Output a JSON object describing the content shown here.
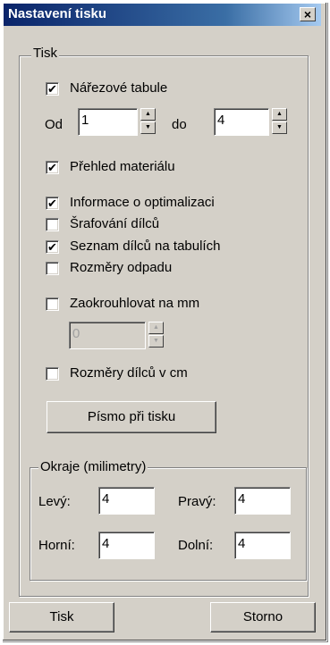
{
  "window": {
    "title": "Nastavení tisku",
    "close_glyph": "×"
  },
  "print_group": {
    "label": "Tisk",
    "cutting_sheets": {
      "label": "Nářezové tabule",
      "checked": true
    },
    "from_label": "Od",
    "from_value": "1",
    "to_label": "do",
    "to_value": "4",
    "material_overview": {
      "label": "Přehled materiálu",
      "checked": true
    },
    "optimization_info": {
      "label": "Informace o optimalizaci",
      "checked": true
    },
    "part_hatching": {
      "label": "Šrafování dílců",
      "checked": false
    },
    "parts_list_on_sheets": {
      "label": "Seznam dílců na tabulích",
      "checked": true
    },
    "waste_dimensions": {
      "label": "Rozměry odpadu",
      "checked": false
    },
    "round_to_mm": {
      "label": "Zaokrouhlovat na mm",
      "checked": false
    },
    "round_value": "0",
    "part_dims_cm": {
      "label": "Rozměry dílců v cm",
      "checked": false
    },
    "font_button": "Písmo při tisku"
  },
  "margins_group": {
    "label": "Okraje (milimetry)",
    "left_label": "Levý:",
    "left_value": "4",
    "right_label": "Pravý:",
    "right_value": "4",
    "top_label": "Horní:",
    "top_value": "4",
    "bottom_label": "Dolní:",
    "bottom_value": "4"
  },
  "buttons": {
    "print": "Tisk",
    "cancel": "Storno"
  },
  "check_glyph": "✔",
  "spin_up_glyph": "▲",
  "spin_down_glyph": "▼"
}
